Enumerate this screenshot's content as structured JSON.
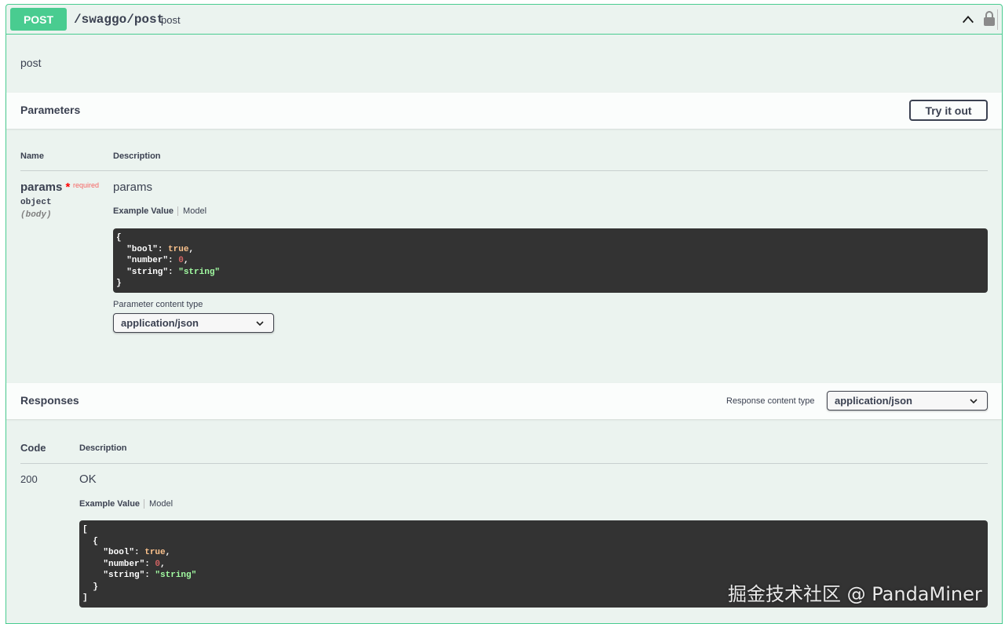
{
  "operation": {
    "method": "POST",
    "path": "/swaggo/post",
    "summary": "post",
    "description": "post"
  },
  "parameters": {
    "title": "Parameters",
    "try_button": "Try it out",
    "col_name": "Name",
    "col_description": "Description",
    "items": [
      {
        "name": "params",
        "required_star": "*",
        "required_label": "required",
        "type": "object",
        "in": "(body)",
        "description": "params",
        "tab_example": "Example Value",
        "tab_model": "Model",
        "content_type_label": "Parameter content type",
        "content_type_value": "application/json"
      }
    ]
  },
  "example_json": {
    "open": "{",
    "close": "}",
    "bool_key": "\"bool\"",
    "bool_val": "true",
    "number_key": "\"number\"",
    "number_val": "0",
    "string_key": "\"string\"",
    "string_val": "\"string\""
  },
  "responses": {
    "title": "Responses",
    "content_type_label": "Response content type",
    "content_type_value": "application/json",
    "col_code": "Code",
    "col_description": "Description",
    "items": [
      {
        "code": "200",
        "description": "OK",
        "tab_example": "Example Value",
        "tab_model": "Model",
        "array_open": "[",
        "array_close": "]"
      }
    ]
  },
  "watermark": "掘金技术社区 @ PandaMiner",
  "colors": {
    "post_green": "#49cc90",
    "block_bg": "#ebf3ef",
    "code_bg": "#333333",
    "text": "#3b4151"
  }
}
